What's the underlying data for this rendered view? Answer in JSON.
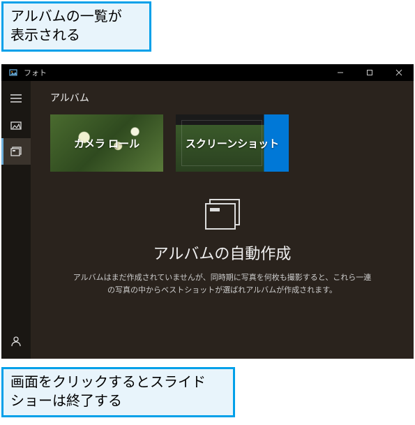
{
  "callouts": {
    "top": "アルバムの一覧が\n表示される",
    "bottom": "画面をクリックするとスライド\nショーは終了する"
  },
  "window": {
    "app_title": "フォト"
  },
  "page": {
    "title": "アルバム"
  },
  "albums": [
    {
      "label": "カメラ ロール"
    },
    {
      "label": "スクリーンショット"
    }
  ],
  "auto_create": {
    "heading": "アルバムの自動作成",
    "body": "アルバムはまだ作成されていませんが、同時期に写真を何枚も撮影すると、これら一連の写真の中からベストショットが選ばれアルバムが作成されます。"
  },
  "sidebar": {
    "items": [
      {
        "name": "hamburger"
      },
      {
        "name": "collection"
      },
      {
        "name": "albums"
      }
    ],
    "footer": {
      "name": "sign-in"
    }
  }
}
